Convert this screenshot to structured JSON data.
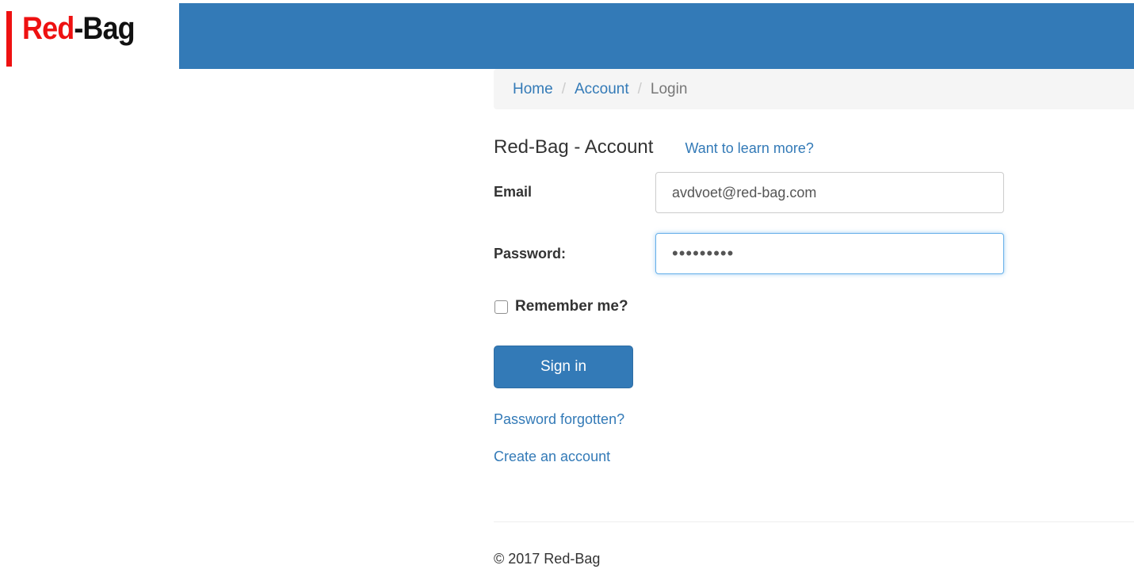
{
  "logo": {
    "part_red": "Red",
    "part_dark": "-Bag",
    "accent_color": "#ee1111"
  },
  "header": {
    "banner_color": "#337ab7"
  },
  "breadcrumb": {
    "home": "Home",
    "account": "Account",
    "current": "Login",
    "separator": "/"
  },
  "page": {
    "title": "Red-Bag - Account",
    "learn_more": "Want to learn more?"
  },
  "form": {
    "email_label": "Email",
    "email_value": "avdvoet@red-bag.com",
    "password_label": "Password:",
    "password_value": "•••••••••",
    "remember_label": "Remember me?",
    "remember_checked": false,
    "submit_label": "Sign in"
  },
  "links": {
    "forgot": "Password forgotten?",
    "create": "Create an account"
  },
  "footer": {
    "copyright": "© 2017 Red-Bag"
  }
}
